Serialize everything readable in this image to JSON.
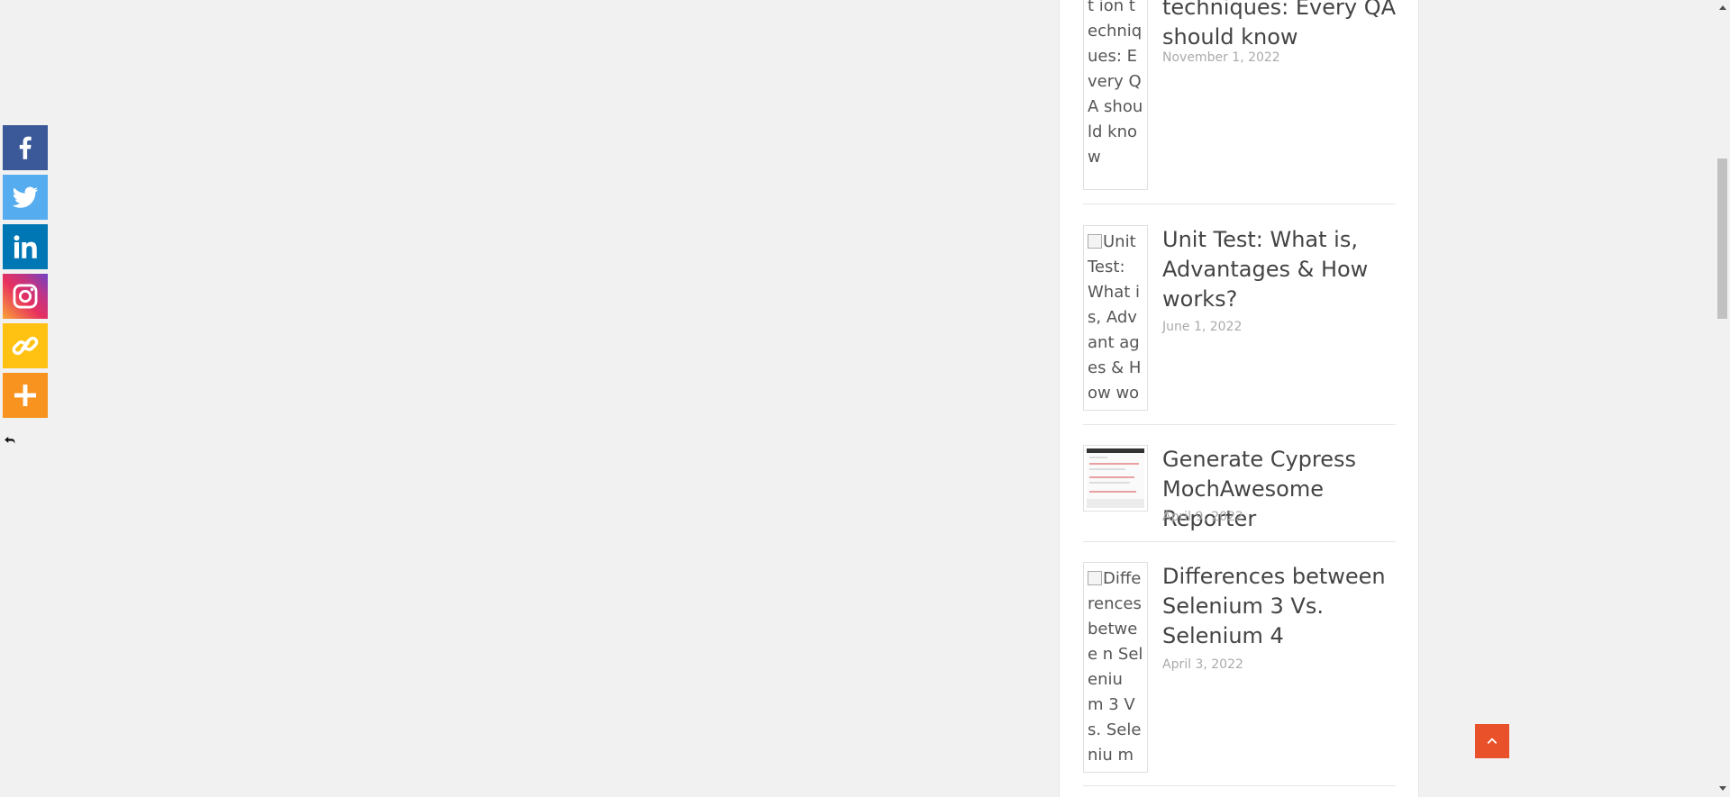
{
  "share_bar": {
    "buttons": [
      {
        "name": "facebook",
        "icon": "facebook-icon",
        "color": "#3b5998"
      },
      {
        "name": "twitter",
        "icon": "twitter-icon",
        "color": "#55acee"
      },
      {
        "name": "linkedin",
        "icon": "linkedin-icon",
        "color": "#0077b5"
      },
      {
        "name": "instagram",
        "icon": "instagram-icon",
        "color": "#c13584"
      },
      {
        "name": "copy-link",
        "icon": "link-icon",
        "color": "#ffc112"
      },
      {
        "name": "more",
        "icon": "plus-icon",
        "color": "#f8931f"
      }
    ],
    "hide_icon": "hand-point-left-icon"
  },
  "posts": [
    {
      "thumb_alt": "Estimation techniques: Every QA should know",
      "thumb_alt_visible": "Estimat ion techniq ues: Every QA should know",
      "title": "techniques: Every QA should know",
      "date": "November 1, 2022"
    },
    {
      "thumb_alt": "Unit Test: What is, Advantages & How works?",
      "thumb_alt_visible": "Unit Test: What is, Advant ages & How works?",
      "title": "Unit Test: What is, Advantages & How works?",
      "date": "June 1, 2022"
    },
    {
      "thumb_alt": "",
      "title": "Generate Cypress MochAwesome Reporter",
      "date": "April 9, 2022"
    },
    {
      "thumb_alt": "Differences between Selenium 3 Vs. Selenium 4",
      "thumb_alt_visible": "Diffe rences betwee n Seleniu m 3 Vs. Seleniu m 4",
      "title": "Differences between Selenium 3 Vs. Selenium 4",
      "date": "April 3, 2022"
    }
  ],
  "scroll_to_top": {
    "icon": "chevron-up-icon",
    "color": "#e8512a"
  },
  "colors": {
    "accent": "#e8512a",
    "background": "#f1f1f1",
    "widget": "#ffffff"
  }
}
